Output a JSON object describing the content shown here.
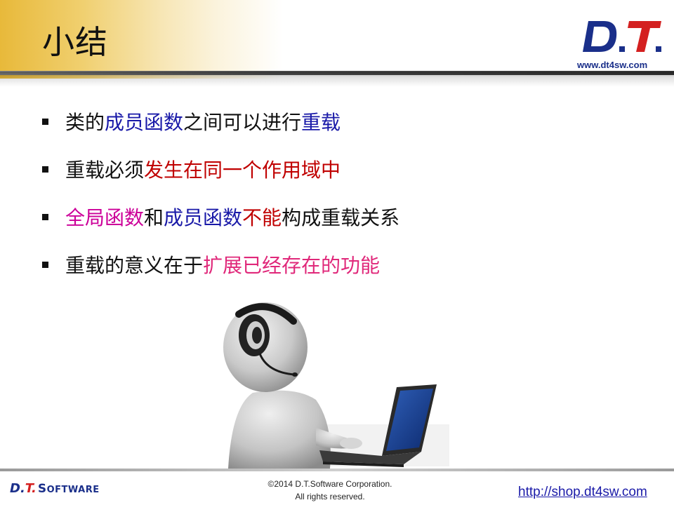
{
  "header": {
    "title": "小结",
    "logo_text": "D.T.",
    "logo_url": "www.dt4sw.com"
  },
  "bullets": [
    {
      "segments": [
        {
          "text": "类的",
          "color": "default"
        },
        {
          "text": "成员函数",
          "color": "blue"
        },
        {
          "text": "之间可以进行",
          "color": "default"
        },
        {
          "text": "重载",
          "color": "blue"
        }
      ]
    },
    {
      "segments": [
        {
          "text": "重载必须",
          "color": "default"
        },
        {
          "text": "发生在同一个作用域中",
          "color": "red"
        }
      ]
    },
    {
      "segments": [
        {
          "text": "全局函数",
          "color": "magenta"
        },
        {
          "text": "和",
          "color": "default"
        },
        {
          "text": "成员函数",
          "color": "blue"
        },
        {
          "text": "不能",
          "color": "red"
        },
        {
          "text": "构成重载关系",
          "color": "default"
        }
      ]
    },
    {
      "segments": [
        {
          "text": "重载的意义在于",
          "color": "default"
        },
        {
          "text": "扩展已经存在的功能",
          "color": "pink"
        }
      ]
    }
  ],
  "footer": {
    "logo_dt": "D.",
    "logo_t": "T.",
    "logo_software_s": "S",
    "logo_software_rest": "OFTWARE",
    "copyright_line1": "©2014 D.T.Software Corporation.",
    "copyright_line2": "All rights reserved.",
    "link": "http://shop.dt4sw.com"
  },
  "colors": {
    "default": "#111111",
    "blue": "#1a1aa8",
    "red": "#c00000",
    "magenta": "#cc0099",
    "pink": "#e0287a",
    "header_gold": "#e8b93a",
    "logo_blue": "#1a2f8a",
    "logo_red": "#d42020"
  }
}
